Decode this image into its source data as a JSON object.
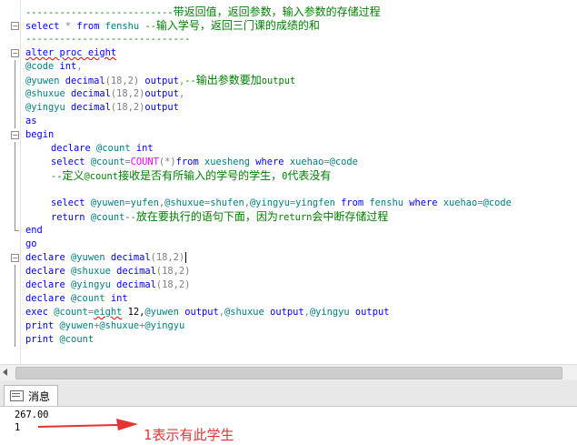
{
  "editor": {
    "lines": [
      {
        "parts": [
          {
            "t": "--------------------------",
            "c": "cm"
          },
          {
            "t": "带返回值，返回参数，输入参数的存储过程",
            "c": "cmcn"
          }
        ],
        "marker": "none"
      },
      {
        "parts": [
          {
            "t": "select",
            "c": "kw"
          },
          {
            "t": " * ",
            "c": "gr"
          },
          {
            "t": "from",
            "c": "kw"
          },
          {
            "t": " fenshu ",
            "c": "id"
          },
          {
            "t": "--",
            "c": "cm"
          },
          {
            "t": "输入学号，返回三门课的成绩的和",
            "c": "cmcn"
          }
        ],
        "marker": "collapse"
      },
      {
        "parts": [
          {
            "t": "-----------------------------",
            "c": "cm"
          }
        ],
        "marker": "none"
      },
      {
        "parts": [
          {
            "t": "alter proc eight",
            "c": "kw",
            "sq": true
          }
        ],
        "marker": "collapse"
      },
      {
        "parts": [
          {
            "t": "@code ",
            "c": "id"
          },
          {
            "t": "int",
            "c": "kw"
          },
          {
            "t": ",",
            "c": "gr"
          }
        ],
        "marker": "line"
      },
      {
        "parts": [
          {
            "t": "@yuwen ",
            "c": "id"
          },
          {
            "t": "decimal",
            "c": "kw"
          },
          {
            "t": "(18,2) ",
            "c": "gr"
          },
          {
            "t": "output",
            "c": "kw"
          },
          {
            "t": ",",
            "c": "gr"
          },
          {
            "t": "--",
            "c": "cm"
          },
          {
            "t": "输出参数要加",
            "c": "cmcn"
          },
          {
            "t": "output",
            "c": "cm"
          }
        ],
        "marker": "line"
      },
      {
        "parts": [
          {
            "t": "@shuxue ",
            "c": "id"
          },
          {
            "t": "decimal",
            "c": "kw"
          },
          {
            "t": "(18,2)",
            "c": "gr"
          },
          {
            "t": "output",
            "c": "kw"
          },
          {
            "t": ",",
            "c": "gr"
          }
        ],
        "marker": "line"
      },
      {
        "parts": [
          {
            "t": "@yingyu ",
            "c": "id"
          },
          {
            "t": "decimal",
            "c": "kw"
          },
          {
            "t": "(18,2)",
            "c": "gr"
          },
          {
            "t": "output",
            "c": "kw"
          }
        ],
        "marker": "line"
      },
      {
        "parts": [
          {
            "t": "as",
            "c": "kw"
          }
        ],
        "marker": "line"
      },
      {
        "parts": [
          {
            "t": "begin",
            "c": "kw"
          }
        ],
        "marker": "collapse"
      },
      {
        "parts": [
          {
            "t": "declare ",
            "c": "kw"
          },
          {
            "t": "@count ",
            "c": "id"
          },
          {
            "t": "int",
            "c": "kw"
          }
        ],
        "marker": "line",
        "indent": true
      },
      {
        "parts": [
          {
            "t": "select ",
            "c": "kw"
          },
          {
            "t": "@count",
            "c": "id"
          },
          {
            "t": "=",
            "c": "gr"
          },
          {
            "t": "COUNT",
            "c": "fn"
          },
          {
            "t": "(*)",
            "c": "gr"
          },
          {
            "t": "from ",
            "c": "kw"
          },
          {
            "t": "xuesheng ",
            "c": "id"
          },
          {
            "t": "where ",
            "c": "kw"
          },
          {
            "t": "xuehao",
            "c": "id"
          },
          {
            "t": "=",
            "c": "gr"
          },
          {
            "t": "@code",
            "c": "id"
          }
        ],
        "marker": "line",
        "indent": true
      },
      {
        "parts": [
          {
            "t": "--",
            "c": "cm"
          },
          {
            "t": "定义",
            "c": "cmcn"
          },
          {
            "t": "@count",
            "c": "cm"
          },
          {
            "t": "接收是否有所输入的学号的学生，",
            "c": "cmcn"
          },
          {
            "t": "0",
            "c": "cm"
          },
          {
            "t": "代表没有",
            "c": "cmcn"
          }
        ],
        "marker": "line",
        "indent": true
      },
      {
        "parts": [
          {
            "t": "",
            "c": "blk"
          }
        ],
        "marker": "line"
      },
      {
        "parts": [
          {
            "t": "select ",
            "c": "kw"
          },
          {
            "t": "@yuwen",
            "c": "id"
          },
          {
            "t": "=",
            "c": "gr"
          },
          {
            "t": "yufen",
            "c": "id"
          },
          {
            "t": ",",
            "c": "gr"
          },
          {
            "t": "@shuxue",
            "c": "id"
          },
          {
            "t": "=",
            "c": "gr"
          },
          {
            "t": "shufen",
            "c": "id"
          },
          {
            "t": ",",
            "c": "gr"
          },
          {
            "t": "@yingyu",
            "c": "id"
          },
          {
            "t": "=",
            "c": "gr"
          },
          {
            "t": "yingfen ",
            "c": "id"
          },
          {
            "t": "from ",
            "c": "kw"
          },
          {
            "t": "fenshu ",
            "c": "id"
          },
          {
            "t": "where ",
            "c": "kw"
          },
          {
            "t": "xuehao",
            "c": "id"
          },
          {
            "t": "=",
            "c": "gr"
          },
          {
            "t": "@code",
            "c": "id"
          }
        ],
        "marker": "line",
        "indent": true
      },
      {
        "parts": [
          {
            "t": "return ",
            "c": "kw"
          },
          {
            "t": "@count",
            "c": "id"
          },
          {
            "t": "--",
            "c": "cm"
          },
          {
            "t": "放在要执行的语句下面，因为",
            "c": "cmcn"
          },
          {
            "t": "return",
            "c": "cm"
          },
          {
            "t": "会中断存储过程",
            "c": "cmcn"
          }
        ],
        "marker": "line",
        "indent": true
      },
      {
        "parts": [
          {
            "t": "end",
            "c": "kw"
          }
        ],
        "marker": "end"
      },
      {
        "parts": [
          {
            "t": "go",
            "c": "kw"
          }
        ],
        "marker": "none"
      },
      {
        "parts": [
          {
            "t": "declare ",
            "c": "kw"
          },
          {
            "t": "@yuwen ",
            "c": "id"
          },
          {
            "t": "decimal",
            "c": "kw"
          },
          {
            "t": "(18,2)",
            "c": "gr"
          }
        ],
        "marker": "collapse",
        "cursor": true
      },
      {
        "parts": [
          {
            "t": "declare ",
            "c": "kw"
          },
          {
            "t": "@shuxue ",
            "c": "id"
          },
          {
            "t": "decimal",
            "c": "kw"
          },
          {
            "t": "(18,2)",
            "c": "gr"
          }
        ],
        "marker": "line"
      },
      {
        "parts": [
          {
            "t": "declare ",
            "c": "kw"
          },
          {
            "t": "@yingyu ",
            "c": "id"
          },
          {
            "t": "decimal",
            "c": "kw"
          },
          {
            "t": "(18,2)",
            "c": "gr"
          }
        ],
        "marker": "line"
      },
      {
        "parts": [
          {
            "t": "declare ",
            "c": "kw"
          },
          {
            "t": "@count ",
            "c": "id"
          },
          {
            "t": "int",
            "c": "kw"
          }
        ],
        "marker": "line"
      },
      {
        "parts": [
          {
            "t": "exec ",
            "c": "kw"
          },
          {
            "t": "@count",
            "c": "id"
          },
          {
            "t": "=",
            "c": "gr"
          },
          {
            "t": "eight",
            "c": "id",
            "sq": true
          },
          {
            "t": " 12,",
            "c": "blk"
          },
          {
            "t": "@yuwen ",
            "c": "id"
          },
          {
            "t": "output",
            "c": "kw"
          },
          {
            "t": ",",
            "c": "gr"
          },
          {
            "t": "@shuxue ",
            "c": "id"
          },
          {
            "t": "output",
            "c": "kw"
          },
          {
            "t": ",",
            "c": "gr"
          },
          {
            "t": "@yingyu ",
            "c": "id"
          },
          {
            "t": "output",
            "c": "kw"
          }
        ],
        "marker": "line"
      },
      {
        "parts": [
          {
            "t": "print ",
            "c": "kw"
          },
          {
            "t": "@yuwen",
            "c": "id"
          },
          {
            "t": "+",
            "c": "gr"
          },
          {
            "t": "@shuxue",
            "c": "id"
          },
          {
            "t": "+",
            "c": "gr"
          },
          {
            "t": "@yingyu",
            "c": "id"
          }
        ],
        "marker": "line"
      },
      {
        "parts": [
          {
            "t": "print ",
            "c": "kw"
          },
          {
            "t": "@count",
            "c": "id"
          }
        ],
        "marker": "line"
      }
    ]
  },
  "results": {
    "tab_label": "消息",
    "tab_icon": "messages-icon",
    "lines": [
      "267.00",
      "1"
    ]
  },
  "annotation": {
    "text": "1表示有此学生",
    "color": "#e53333"
  },
  "colors": {
    "keyword": "#0000ff",
    "function": "#ff00ff",
    "operator": "#808080",
    "comment": "#008000",
    "identifier": "#008080"
  }
}
